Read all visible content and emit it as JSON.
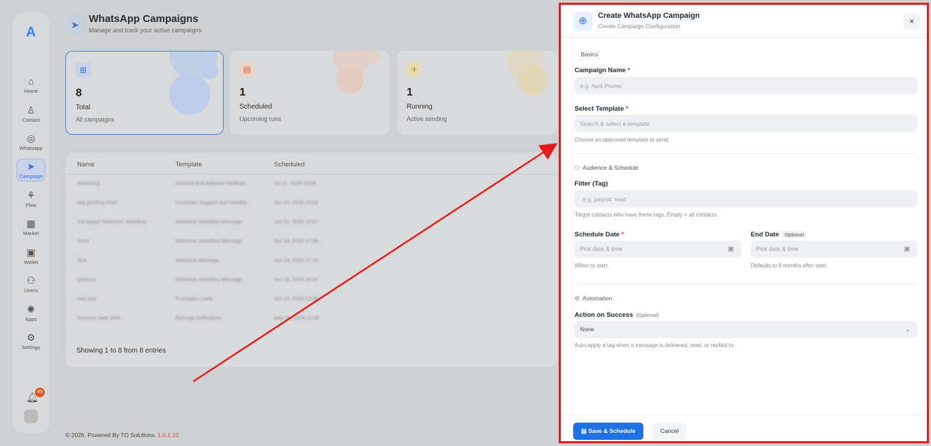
{
  "sidebar": {
    "logo": "A",
    "items": [
      {
        "label": "Home",
        "icon": "⌂"
      },
      {
        "label": "Contact",
        "icon": "♙"
      },
      {
        "label": "Whatsapp",
        "icon": "◎"
      },
      {
        "label": "Campaign",
        "icon": "➤"
      },
      {
        "label": "Flow",
        "icon": "⚘"
      },
      {
        "label": "Market",
        "icon": "▦"
      },
      {
        "label": "Wallet",
        "icon": "▣"
      },
      {
        "label": "Users",
        "icon": "⚇"
      },
      {
        "label": "Apps",
        "icon": "✺"
      },
      {
        "label": "Settings",
        "icon": "⚙"
      }
    ],
    "notification_count": "45"
  },
  "header": {
    "title": "WhatsApp Campaigns",
    "subtitle": "Manage and track your active campaigns"
  },
  "stats": [
    {
      "value": "8",
      "label": "Total",
      "desc": "All campaigns",
      "icon": "⊞"
    },
    {
      "value": "1",
      "label": "Scheduled",
      "desc": "Upcoming runs",
      "icon": "▤"
    },
    {
      "value": "1",
      "label": "Running",
      "desc": "Active sending",
      "icon": "✈"
    }
  ],
  "table": {
    "columns": [
      "Name",
      "Template",
      "Scheduled"
    ],
    "rows": [
      [
        "Marketing",
        "Account and Address Verificati...",
        "Jul 11, 2026 12:08"
      ],
      [
        "hey grishma here",
        "Customer Support and Feedba...",
        "Jun 24, 2026 15:59"
      ],
      [
        "Campaign Welcome Jewellery...",
        "Welcome Jewellery Message",
        "Jun 22, 2026 12:07"
      ],
      [
        "Test1",
        "Welcome Jewellery Message",
        "Jun 19, 2026 17:58"
      ],
      [
        "Test",
        "Welcome Message",
        "Jun 18, 2026 17:15"
      ],
      [
        "grishma",
        "Welcome Jewellery Message",
        "Jun 16, 2026 18:20"
      ],
      [
        "new test",
        "Purchase Leads",
        "Jun 21, 2026 12:05"
      ],
      [
        "Summer Sale 25%",
        "Earrings Collections",
        "May 20, 2026 12:45"
      ]
    ],
    "footer": "Showing 1 to 8 from 8 entries"
  },
  "footer": {
    "text": "© 2026. Powered By TO Solutions.",
    "version": "1.0.1.10"
  },
  "modal": {
    "title": "Create WhatsApp Campaign",
    "subtitle": "Create Campaign Configuration",
    "close": "×",
    "sections": {
      "basics": "Basics",
      "audience": "Audience & Schedule",
      "automation": "Automation"
    },
    "campaign_name": {
      "label": "Campaign Name",
      "required": "*",
      "placeholder": "e.g. April Promo"
    },
    "template": {
      "label": "Select Template",
      "required": "*",
      "placeholder": "Search & select a template",
      "hint": "Choose an approved template to send."
    },
    "filter": {
      "label": "Filter (Tag)",
      "placeholder": "e.g. payroll, lead",
      "hint": "Target contacts who have these tags. Empty = all contacts."
    },
    "schedule_date": {
      "label": "Schedule Date",
      "required": "*",
      "placeholder": "Pick date & time",
      "hint": "When to start."
    },
    "end_date": {
      "label": "End Date",
      "optional": "Optional",
      "placeholder": "Pick date & time",
      "hint": "Defaults to 6 months after start."
    },
    "action": {
      "label": "Action on Success",
      "optional": "(Optional)",
      "value": "None",
      "hint": "Auto-apply a tag when a message is delivered, read, or replied to."
    },
    "save_label": "Save & Schedule",
    "cancel_label": "Cancel"
  },
  "colors": {
    "accent": "#1f6fe5",
    "highlight_border": "#e21b1b",
    "arrow": "#e21b1b"
  }
}
